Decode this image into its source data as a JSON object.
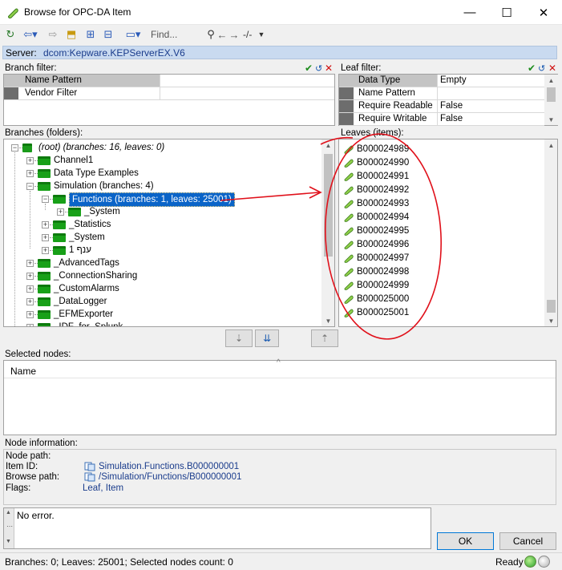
{
  "window": {
    "title": "Browse for OPC-DA Item",
    "minimize": "—",
    "maximize": "☐",
    "close": "✕"
  },
  "toolbar": {
    "find_placeholder": "Find...",
    "path_sep": "-/-"
  },
  "server": {
    "label": "Server:",
    "value": "dcom:Kepware.KEPServerEX.V6"
  },
  "branch_filter": {
    "label": "Branch filter:",
    "rows": [
      {
        "name": "Name Pattern",
        "value": ""
      },
      {
        "name": "Vendor Filter",
        "value": ""
      }
    ]
  },
  "leaf_filter": {
    "label": "Leaf filter:",
    "rows": [
      {
        "name": "Data Type",
        "value": "Empty"
      },
      {
        "name": "Name Pattern",
        "value": ""
      },
      {
        "name": "Require Readable",
        "value": "False"
      },
      {
        "name": "Require Writable",
        "value": "False"
      }
    ]
  },
  "branches": {
    "label": "Branches (folders):",
    "items": [
      {
        "text": "(root) (branches: 16, leaves: 0)",
        "level": 0,
        "expander": "−",
        "italic": true
      },
      {
        "text": "Channel1",
        "level": 1,
        "expander": "+"
      },
      {
        "text": "Data Type Examples",
        "level": 1,
        "expander": "+"
      },
      {
        "text": "Simulation (branches: 4)",
        "level": 1,
        "expander": "−"
      },
      {
        "text": "Functions (branches: 1, leaves: 25001)",
        "level": 2,
        "expander": "−",
        "selected": true
      },
      {
        "text": "_System",
        "level": 3,
        "expander": "+"
      },
      {
        "text": "_Statistics",
        "level": 2,
        "expander": "+"
      },
      {
        "text": "_System",
        "level": 2,
        "expander": "+"
      },
      {
        "text": "ענף 1",
        "level": 2,
        "expander": "+"
      },
      {
        "text": "_AdvancedTags",
        "level": 1,
        "expander": "+"
      },
      {
        "text": "_ConnectionSharing",
        "level": 1,
        "expander": "+"
      },
      {
        "text": "_CustomAlarms",
        "level": 1,
        "expander": "+"
      },
      {
        "text": "_DataLogger",
        "level": 1,
        "expander": "+"
      },
      {
        "text": "_EFMExporter",
        "level": 1,
        "expander": "+"
      },
      {
        "text": "_IDF_for_Splunk",
        "level": 1,
        "expander": "+"
      }
    ]
  },
  "leaves": {
    "label": "Leaves (items):",
    "items": [
      "B000024989",
      "B000024990",
      "B000024991",
      "B000024992",
      "B000024993",
      "B000024994",
      "B000024995",
      "B000024996",
      "B000024997",
      "B000024998",
      "B000024999",
      "B000025000",
      "B000025001"
    ]
  },
  "selected_nodes": {
    "label": "Selected nodes:",
    "column": "Name"
  },
  "node_info": {
    "label": "Node information:",
    "node_path_label": "Node path:",
    "item_id_label": "Item ID:",
    "item_id_value": "Simulation.Functions.B000000001",
    "browse_path_label": "Browse path:",
    "browse_path_value": "/Simulation/Functions/B000000001",
    "flags_label": "Flags:",
    "flags_value": "Leaf, Item"
  },
  "message": "No error.",
  "buttons": {
    "ok": "OK",
    "cancel": "Cancel"
  },
  "status": {
    "text": "Branches: 0; Leaves: 25001; Selected nodes count: 0",
    "ready": "Ready"
  },
  "colors": {
    "folder": "#18a018",
    "selection": "#0a64c8",
    "annotation": "#e0101a",
    "server_bar": "#c9daf0"
  }
}
